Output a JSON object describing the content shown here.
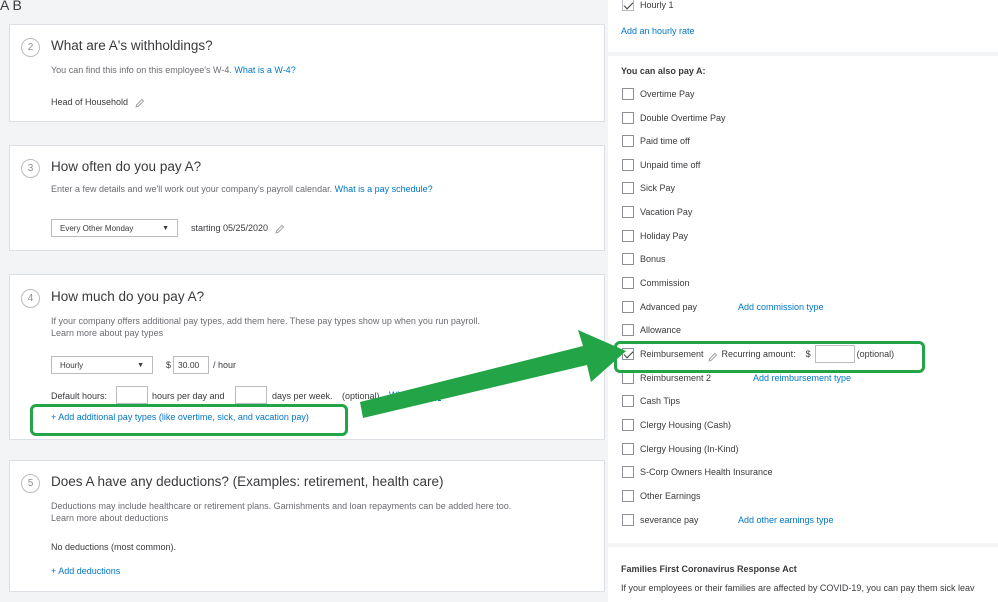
{
  "header": {
    "name": "A B"
  },
  "withholdings": {
    "step": "2",
    "title": "What are A's withholdings?",
    "subtitle": "You can find this info on this employee's W-4.",
    "link": "What is a W-4?",
    "filing_status": "Head of Household"
  },
  "schedule": {
    "step": "3",
    "title": "How often do you pay A?",
    "subtitle": "Enter a few details and we'll work out your company's payroll calendar.",
    "link": "What is a pay schedule?",
    "frequency": "Every Other Monday",
    "starting": "starting 05/25/2020"
  },
  "pay": {
    "step": "4",
    "title": "How much do you pay A?",
    "subtitle": "If your company offers additional pay types, add them here. These pay types show up when you run payroll.",
    "link": "Learn more about pay types",
    "pay_type": "Hourly",
    "currency": "$",
    "rate": "30.00",
    "rate_unit": "/ hour",
    "default_hours_label": "Default hours:",
    "hours_per_day_label": "hours per day and",
    "days_per_week_label": "days per week.",
    "optional": "(optional)",
    "what_are_link": "What are def",
    "add_types_link": "+ Add additional pay types (like overtime, sick, and vacation pay)"
  },
  "deductions": {
    "step": "5",
    "title": "Does A have any deductions? (Examples: retirement, health care)",
    "subtitle": "Deductions may include healthcare or retirement plans. Garnishments and loan repayments can be added here too.",
    "link": "Learn more about deductions",
    "status": "No deductions (most common).",
    "add_link": "+ Add deductions"
  },
  "right_panel": {
    "hourly_item": "Hourly 1",
    "add_hourly_link": "Add an hourly rate",
    "also_pay_heading": "You can also pay A:",
    "items": [
      {
        "label": "Overtime Pay",
        "checked": false
      },
      {
        "label": "Double Overtime Pay",
        "checked": false
      },
      {
        "label": "Paid time off",
        "checked": false
      },
      {
        "label": "Unpaid time off",
        "checked": false
      },
      {
        "label": "Sick Pay",
        "checked": false
      },
      {
        "label": "Vacation Pay",
        "checked": false
      },
      {
        "label": "Holiday Pay",
        "checked": false
      },
      {
        "label": "Bonus",
        "checked": false
      },
      {
        "label": "Commission",
        "checked": false
      },
      {
        "label": "Advanced pay",
        "checked": false
      },
      {
        "label": "Allowance",
        "checked": false
      },
      {
        "label": "Reimbursement",
        "checked": true
      },
      {
        "label": "Reimbursement 2",
        "checked": false
      },
      {
        "label": "Cash Tips",
        "checked": false
      },
      {
        "label": "Clergy Housing (Cash)",
        "checked": false
      },
      {
        "label": "Clergy Housing (In-Kind)",
        "checked": false
      },
      {
        "label": "S-Corp Owners Health Insurance",
        "checked": false
      },
      {
        "label": "Other Earnings",
        "checked": false
      },
      {
        "label": "severance pay",
        "checked": false
      }
    ],
    "add_commission_link": "Add commission type",
    "add_reimbursement_link": "Add reimbursement type",
    "add_other_earnings_link": "Add other earnings type",
    "recurring_label": "Recurring amount:",
    "recurring_currency": "$",
    "recurring_optional": "(optional)",
    "ffcra_heading": "Families First Coronavirus Response Act",
    "ffcra_text": "If your employees or their families are affected by COVID-19, you can pay them sick leav"
  },
  "annotation": {
    "color": "#22a447"
  }
}
